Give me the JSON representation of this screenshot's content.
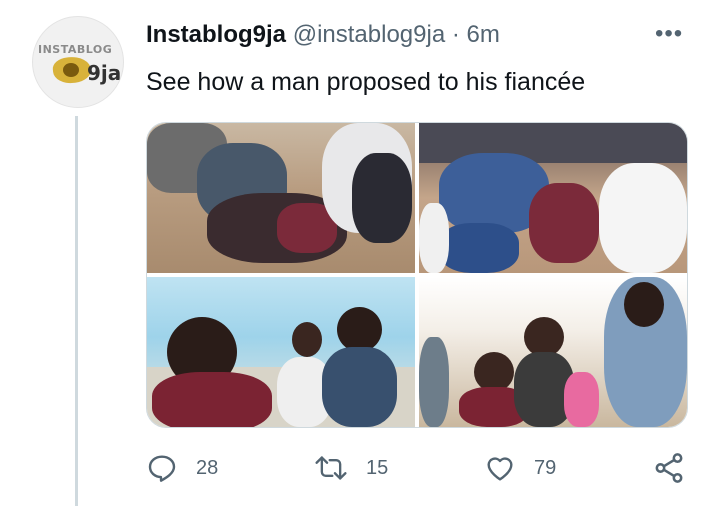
{
  "tweet": {
    "author_name": "Instablog9ja",
    "handle": "@instablog9ja",
    "separator": "·",
    "time": "6m",
    "text": "See how a man proposed to his fiancée",
    "more_label": "•••"
  },
  "avatar": {
    "logo_text_top": "INSTABLOG",
    "logo_text_bottom": "9ja"
  },
  "media": {
    "photos": [
      {
        "name": "photo-1",
        "alt": "photo"
      },
      {
        "name": "photo-2",
        "alt": "photo"
      },
      {
        "name": "photo-3",
        "alt": "photo"
      },
      {
        "name": "photo-4",
        "alt": "photo"
      }
    ]
  },
  "actions": {
    "reply_count": "28",
    "retweet_count": "15",
    "like_count": "79",
    "icons": [
      "reply-icon",
      "retweet-icon",
      "like-icon",
      "share-icon"
    ]
  },
  "colors": {
    "secondary_text": "#536471",
    "primary_text": "#0f1419",
    "border": "#cfd9de"
  }
}
